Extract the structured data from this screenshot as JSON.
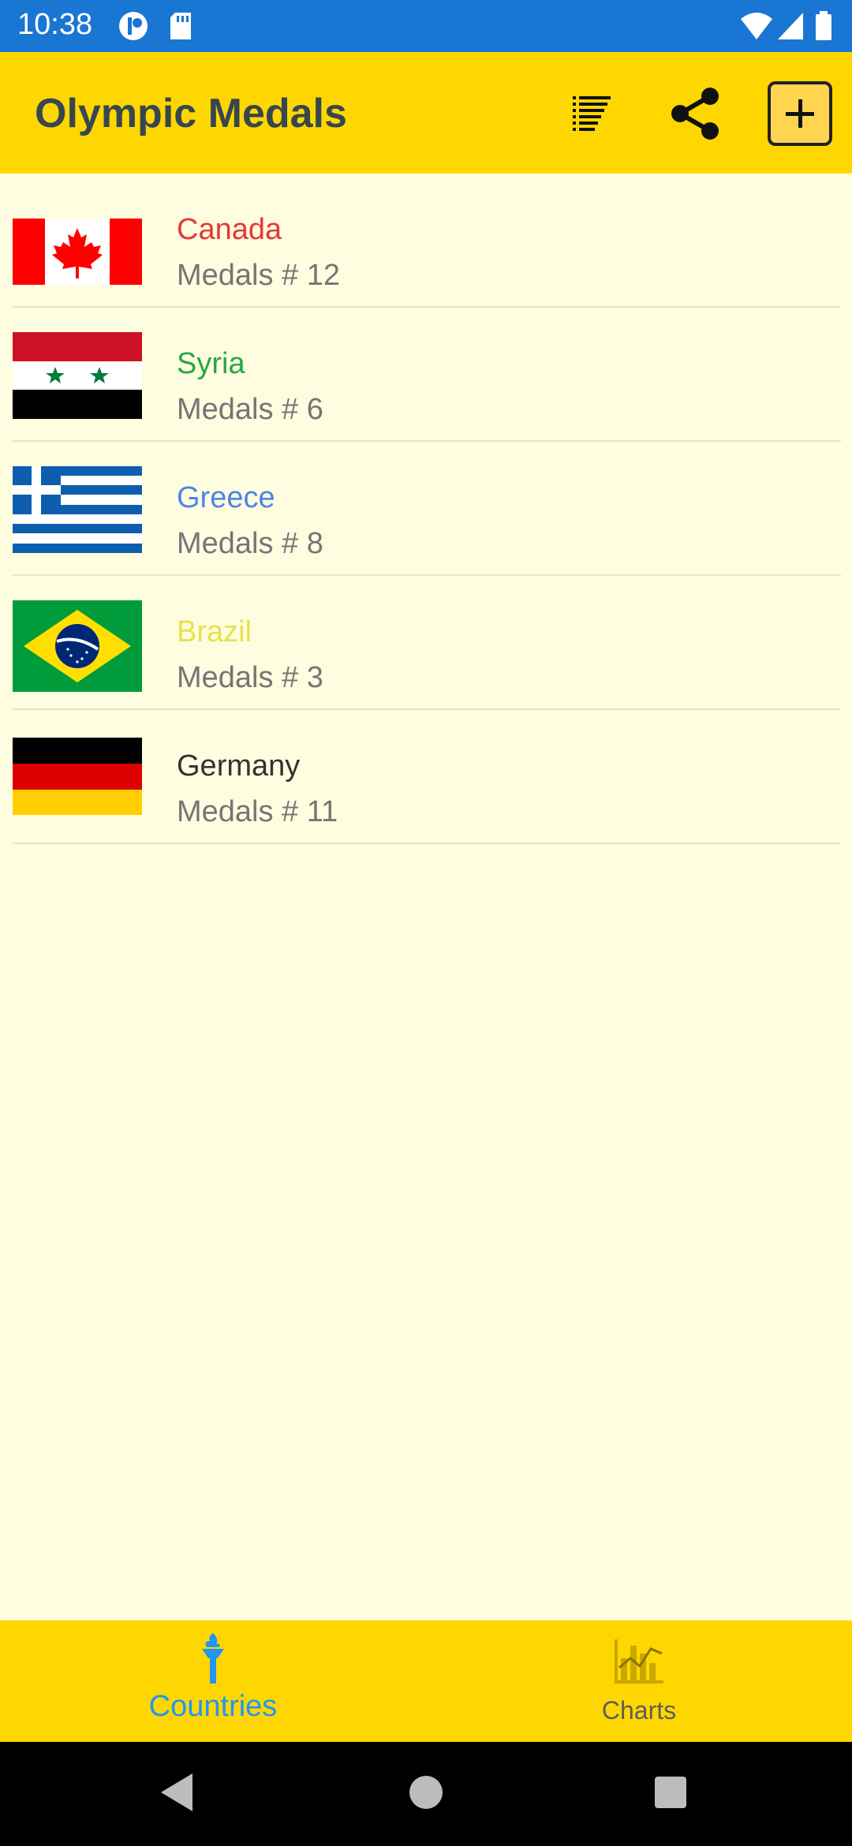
{
  "status_bar": {
    "time": "10:38"
  },
  "app_bar": {
    "title": "Olympic Medals",
    "actions": [
      "sort-icon",
      "share-icon",
      "add-icon"
    ]
  },
  "countries": [
    {
      "name": "Canada",
      "medals_text": "Medals # 12",
      "name_color": "#E53935"
    },
    {
      "name": "Syria",
      "medals_text": "Medals # 6",
      "name_color": "#27A745"
    },
    {
      "name": "Greece",
      "medals_text": "Medals # 8",
      "name_color": "#4A86E8"
    },
    {
      "name": "Brazil",
      "medals_text": "Medals # 3",
      "name_color": "#E6E24A"
    },
    {
      "name": "Germany",
      "medals_text": "Medals # 11",
      "name_color": "#333333"
    }
  ],
  "bottom_nav": {
    "countries_label": "Countries",
    "charts_label": "Charts",
    "active_color": "#2196F3",
    "inactive_color": "#5D5D5D"
  },
  "colors": {
    "status_bar": "#1976D2",
    "app_bar": "#FFD700",
    "background": "#FFFDE0"
  }
}
